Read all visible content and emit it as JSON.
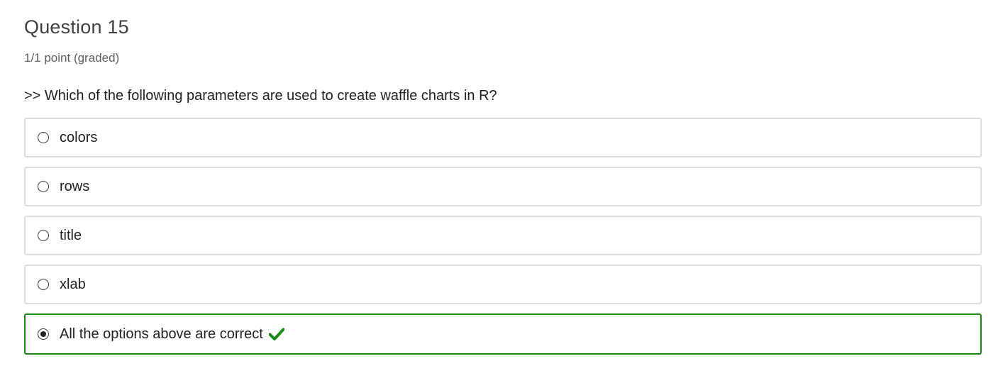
{
  "question": {
    "title": "Question 15",
    "points": "1/1 point (graded)",
    "prompt": ">> Which of the following parameters are used to create waffle charts in R?"
  },
  "choices": [
    {
      "label": "colors",
      "selected": false,
      "correct": false
    },
    {
      "label": "rows",
      "selected": false,
      "correct": false
    },
    {
      "label": "title",
      "selected": false,
      "correct": false
    },
    {
      "label": "xlab",
      "selected": false,
      "correct": false
    },
    {
      "label": "All the options above are correct",
      "selected": true,
      "correct": true
    }
  ],
  "colors": {
    "correct": "#178a17",
    "border": "#dedede"
  },
  "icons": {
    "correct_indicator": "checkmark-icon"
  }
}
